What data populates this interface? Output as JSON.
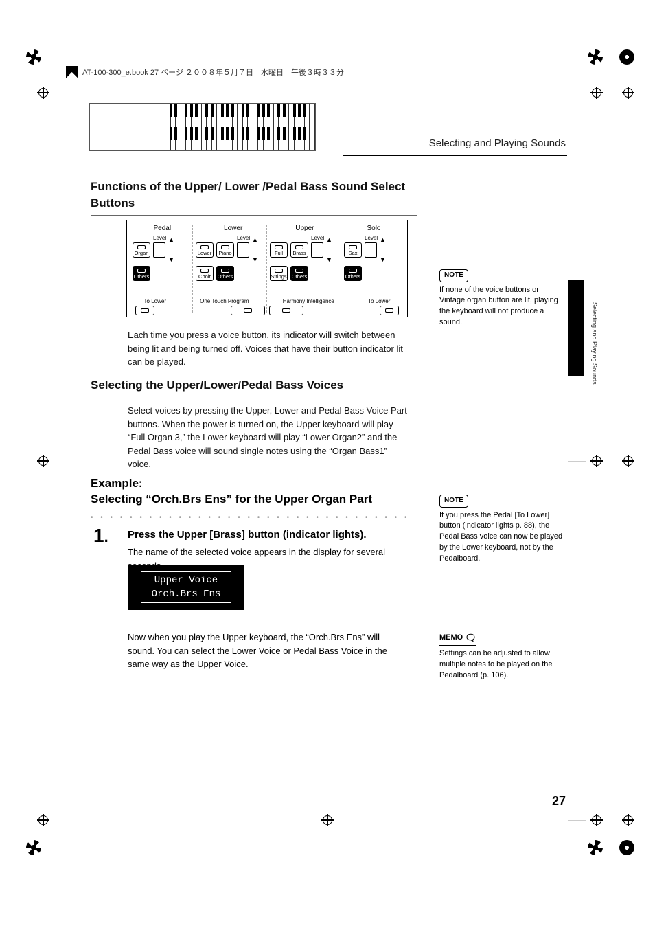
{
  "print_header": "AT-100-300_e.book  27 ページ  ２００８年５月７日　水曜日　午後３時３３分",
  "running_head": "Selecting and Playing Sounds",
  "side_tab_label": "Selecting and Playing Sounds",
  "headings": {
    "functions": "Functions of the Upper/ Lower /Pedal Bass Sound Select Buttons",
    "selecting": "Selecting the Upper/Lower/Pedal Bass Voices"
  },
  "panel": {
    "top_groups": [
      "Pedal",
      "Lower",
      "Upper",
      "Solo"
    ],
    "pedal": {
      "row1": [
        "Organ"
      ],
      "row2": [
        "Others"
      ],
      "level": "Level"
    },
    "lower": {
      "row1": [
        "Lower",
        "Piano"
      ],
      "row2": [
        "Choir",
        "Others"
      ],
      "level": "Level"
    },
    "upper": {
      "row1": [
        "Full",
        "Brass"
      ],
      "row2": [
        "Strings",
        "Others"
      ],
      "level": "Level"
    },
    "solo": {
      "row1": [
        "Sax"
      ],
      "row2": [
        "Others"
      ],
      "level": "Level"
    },
    "bottom_labels": [
      "To Lower",
      "One Touch Program",
      "Harmony Intelligence",
      "To Lower"
    ]
  },
  "body": {
    "functions_para": "Each time you press a voice button, its indicator will switch between being lit and being turned off. Voices that have their button indicator lit can be played.",
    "selecting_para": "Select voices by pressing the Upper, Lower and Pedal Bass Voice Part buttons. When the power is turned on, the Upper keyboard will play “Full Organ 3,” the Lower keyboard will play “Lower Organ2” and the Pedal Bass voice will sound single notes using the “Organ Bass1” voice."
  },
  "example": {
    "line1": "Example:",
    "line2": "Selecting “Orch.Brs Ens” for the Upper Organ Part"
  },
  "step1": {
    "num": "1",
    "title": "Press the Upper [Brass] button (indicator lights).",
    "para": "The name of the selected voice appears in the display for several seconds.",
    "after": "Now when you play the Upper keyboard, the “Orch.Brs Ens” will sound. You can select the Lower Voice or Pedal Bass Voice in the same way as the Upper Voice."
  },
  "lcd": {
    "line1": "Upper Voice",
    "line2": "Orch.Brs Ens"
  },
  "sidenotes": {
    "note1_tag": "NOTE",
    "note1": "If none of the voice buttons or Vintage organ button are lit, playing the keyboard will not produce a sound.",
    "note2_tag": "NOTE",
    "note2": "If you press the Pedal [To Lower] button (indicator lights p. 88), the Pedal Bass voice can now be played by the Lower keyboard, not by the Pedalboard.",
    "memo_tag": "MEMO",
    "memo": "Settings can be adjusted to allow multiple notes to be played on the Pedalboard (p. 106)."
  },
  "page_number": "27"
}
